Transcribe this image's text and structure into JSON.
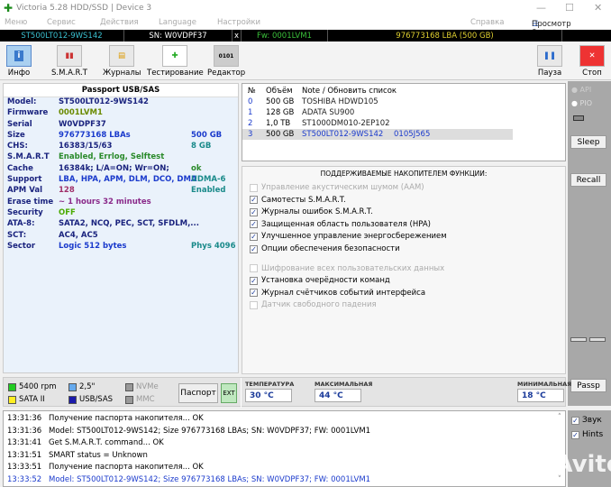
{
  "window": {
    "title": "Victoria 5.28 HDD/SSD | Device 3"
  },
  "menu": [
    "Меню",
    "Сервис",
    "Действия",
    "Language",
    "Настройки",
    "Справка",
    "Просмотр буфера"
  ],
  "drive_bar": {
    "model": "ST500LT012-9WS142",
    "serial": "SN: W0VDPF37",
    "close": "x",
    "firmware": "Fw: 0001LVM1",
    "capacity": "976773168 LBA (500 GB)"
  },
  "toolbar": [
    {
      "label": "Инфо",
      "icon": "info-icon"
    },
    {
      "label": "S.M.A.R.T",
      "icon": "smart-icon"
    },
    {
      "label": "Журналы",
      "icon": "journal-icon"
    },
    {
      "label": "Тестирование",
      "icon": "test-icon"
    },
    {
      "label": "Редактор",
      "icon": "editor-icon"
    },
    {
      "label": "Пауза",
      "icon": "pause-icon"
    },
    {
      "label": "Стоп",
      "icon": "stop-icon"
    }
  ],
  "passport": {
    "title": "Passport USB/SAS",
    "rows": [
      {
        "k": "Model:",
        "v": "ST500LT012-9WS142",
        "x": "",
        "vc": "#1a237e",
        "xc": ""
      },
      {
        "k": "Firmware",
        "v": "0001LVM1",
        "x": "",
        "vc": "#6a8a00",
        "xc": ""
      },
      {
        "k": "Serial",
        "v": "W0VDPF37",
        "x": "",
        "vc": "#1a237e",
        "xc": ""
      },
      {
        "k": "Size",
        "v": "976773168 LBAs",
        "x": "500 GB",
        "vc": "#1a3acc",
        "xc": "#1a3acc"
      },
      {
        "k": "CHS:",
        "v": "16383/15/63",
        "x": "8 GB",
        "vc": "#1a237e",
        "xc": "#1a8a8a"
      },
      {
        "k": "S.M.A.R.T",
        "v": "Enabled, Errlog, Selftest",
        "x": "",
        "vc": "#2a8a2a",
        "xc": ""
      },
      {
        "k": "Cache",
        "v": "16384k; L/A=ON; Wr=ON;",
        "x": "ok",
        "vc": "#1a237e",
        "xc": "#2a8a2a"
      },
      {
        "k": "Support",
        "v": "LBA, HPA, APM, DLM, DCO, DMA",
        "x": "UDMA-6",
        "vc": "#1a3acc",
        "xc": "#1a8a8a"
      },
      {
        "k": "APM Val",
        "v": "128",
        "x": "Enabled",
        "vc": "#a0306a",
        "xc": "#1a8a8a"
      },
      {
        "k": "Erase time",
        "v": "~ 1 hours 32 minutes",
        "x": "",
        "vc": "#8a2a8a",
        "xc": ""
      },
      {
        "k": "Security",
        "v": "OFF",
        "x": "",
        "vc": "#4aaa00",
        "xc": ""
      },
      {
        "k": "ATA-8:",
        "v": "SATA2, NCQ, PEC, SCT, SFDLM,...",
        "x": "",
        "vc": "#1a237e",
        "xc": ""
      },
      {
        "k": "SCT:",
        "v": "AC4, AC5",
        "x": "",
        "vc": "#1a237e",
        "xc": ""
      },
      {
        "k": "Sector",
        "v": "Logic 512 bytes",
        "x": "Phys 4096",
        "vc": "#1a3acc",
        "xc": "#1a8a8a"
      }
    ]
  },
  "drive_list": {
    "headers": [
      "№",
      "Объём",
      "Note / Обновить список"
    ],
    "rows": [
      {
        "n": "0",
        "size": "500 GB",
        "note": "TOSHIBA HDWD105",
        "extra": ""
      },
      {
        "n": "1",
        "size": "128 GB",
        "note": "ADATA SU900",
        "extra": ""
      },
      {
        "n": "2",
        "size": "1,0 TB",
        "note": "ST1000DM010-2EP102",
        "extra": ""
      },
      {
        "n": "3",
        "size": "500 GB",
        "note": "ST500LT012-9WS142",
        "extra": "0105J565",
        "selected": true
      }
    ]
  },
  "functions": {
    "title": "ПОДДЕРЖИВАЕМЫЕ НАКОПИТЕЛЕМ ФУНКЦИИ:",
    "items": [
      {
        "label": "Управление акустическим шумом (AAM)",
        "checked": false,
        "enabled": false
      },
      {
        "label": "Самотесты S.M.A.R.T.",
        "checked": true,
        "enabled": true
      },
      {
        "label": "Журналы ошибок S.M.A.R.T.",
        "checked": true,
        "enabled": true
      },
      {
        "label": "Защищенная область пользователя (HPA)",
        "checked": true,
        "enabled": true
      },
      {
        "label": "Улучшенное управление энергосбережением",
        "checked": true,
        "enabled": true
      },
      {
        "label": "Опции обеспечения безопасности",
        "checked": true,
        "enabled": true
      },
      {
        "label": "Шифрование всех пользовательских данных",
        "checked": false,
        "enabled": false
      },
      {
        "label": "Установка очерёдности команд",
        "checked": true,
        "enabled": true
      },
      {
        "label": "Журнал счётчиков событий интерфейса",
        "checked": true,
        "enabled": true
      },
      {
        "label": "Датчик свободного падения",
        "checked": false,
        "enabled": false
      }
    ]
  },
  "side": {
    "api": "API",
    "pio": "PIO",
    "sleep": "Sleep",
    "recall": "Recall",
    "passp": "Passp"
  },
  "status": {
    "legend": [
      {
        "label": "5400 rpm",
        "color": "#22cc22"
      },
      {
        "label": "SATA II",
        "color": "#ffee22"
      },
      {
        "label": "2,5\"",
        "color": "#66aaee"
      },
      {
        "label": "USB/SAS",
        "color": "#1a1aaa"
      },
      {
        "label": "NVMe",
        "color": "#999999"
      },
      {
        "label": "MMC",
        "color": "#999999"
      }
    ],
    "passport_btn": "Паспорт",
    "ext_btn": "EXT",
    "temp_label": "ТЕМПЕРАТУРА",
    "temp": "30 °C",
    "max_label": "МАКСИМАЛЬНАЯ",
    "max": "44 °C",
    "min_label": "МИНИМАЛЬНАЯ",
    "min": "18 °C"
  },
  "log": [
    {
      "t": "13:31:36",
      "m": "Получение паспорта накопителя... OK",
      "c": "#000"
    },
    {
      "t": "13:31:36",
      "m": "Model: ST500LT012-9WS142; Size 976773168 LBAs; SN: W0VDPF37; FW: 0001LVM1",
      "c": "#000"
    },
    {
      "t": "13:31:41",
      "m": "Get S.M.A.R.T. command... OK",
      "c": "#000"
    },
    {
      "t": "13:31:51",
      "m": "SMART status = Unknown",
      "c": "#000"
    },
    {
      "t": "13:33:51",
      "m": "Получение паспорта накопителя... OK",
      "c": "#000"
    },
    {
      "t": "13:33:52",
      "m": "Model: ST500LT012-9WS142; Size 976773168 LBAs; SN: W0VDPF37; FW: 0001LVM1",
      "c": "#1a3acc"
    }
  ],
  "log_options": {
    "sound": "Звук",
    "hints": "Hints"
  },
  "watermark": "Avito"
}
